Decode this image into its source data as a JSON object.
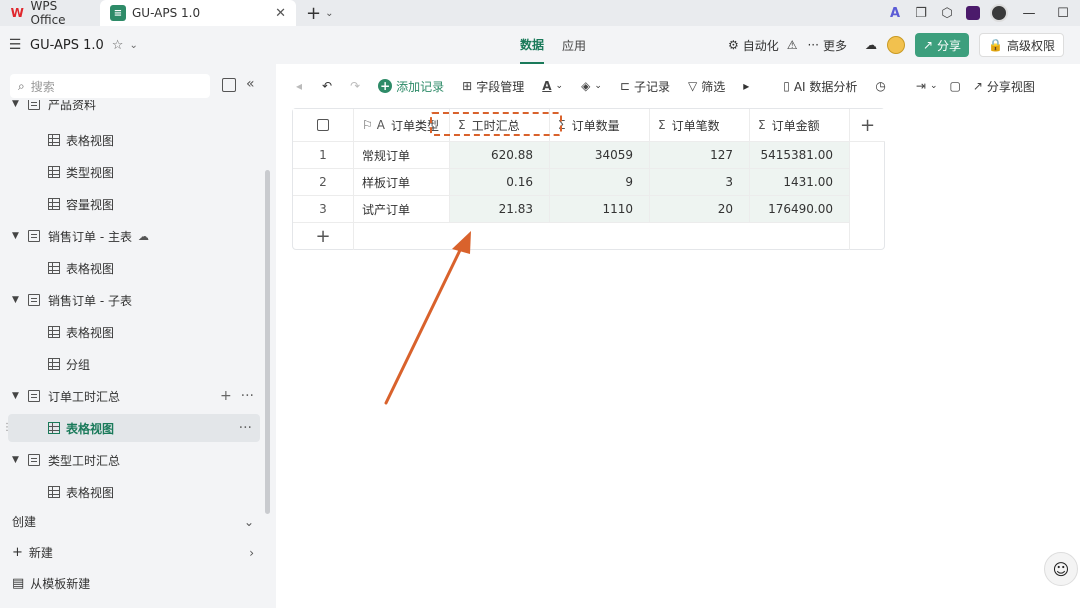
{
  "titlebar": {
    "tabs": [
      {
        "label": "WPS Office",
        "icon": "wps-logo-icon"
      },
      {
        "label": "GU-APS 1.0",
        "icon": "table-app-icon",
        "active": true
      }
    ],
    "close_glyph": "✕",
    "new_tab_glyph": "+",
    "window": {
      "minimize": "—",
      "maximize": "☐"
    }
  },
  "header": {
    "doc_title": "GU-APS 1.0",
    "tabs": [
      "数据",
      "应用"
    ],
    "active_tab": "数据",
    "automation": "自动化",
    "more": "更多",
    "share": "分享",
    "permission": "高级权限"
  },
  "sidebar": {
    "search_placeholder": "搜索",
    "items": [
      {
        "label": "产品资料",
        "type": "table",
        "expanded": true
      },
      {
        "label": "表格视图",
        "type": "view"
      },
      {
        "label": "类型视图",
        "type": "view"
      },
      {
        "label": "容量视图",
        "type": "view"
      },
      {
        "label": "销售订单 - 主表",
        "type": "table",
        "expanded": true
      },
      {
        "label": "表格视图",
        "type": "view"
      },
      {
        "label": "销售订单 - 子表",
        "type": "table",
        "expanded": true
      },
      {
        "label": "表格视图",
        "type": "view"
      },
      {
        "label": "分组",
        "type": "view"
      },
      {
        "label": "订单工时汇总",
        "type": "table",
        "expanded": true
      },
      {
        "label": "表格视图",
        "type": "view",
        "selected": true
      },
      {
        "label": "类型工时汇总",
        "type": "table",
        "expanded": true
      },
      {
        "label": "表格视图",
        "type": "view"
      }
    ],
    "create_section": "创建",
    "new_label": "新建",
    "template_label": "从模板新建"
  },
  "toolbar": {
    "add_record": "添加记录",
    "field_manage": "字段管理",
    "sub_record": "子记录",
    "filter": "筛选",
    "ai_analysis": "AI 数据分析",
    "share_view": "分享视图"
  },
  "table": {
    "columns": [
      {
        "label": "订单类型",
        "icon": "A"
      },
      {
        "label": "工时汇总",
        "icon": "Σ"
      },
      {
        "label": "订单数量",
        "icon": "Σ"
      },
      {
        "label": "订单笔数",
        "icon": "Σ"
      },
      {
        "label": "订单金额",
        "icon": "Σ"
      }
    ],
    "rows": [
      {
        "idx": "1",
        "type": "常规订单",
        "hours": "620.88",
        "qty": "34059",
        "count": "127",
        "amount": "5415381.00"
      },
      {
        "idx": "2",
        "type": "样板订单",
        "hours": "0.16",
        "qty": "9",
        "count": "3",
        "amount": "1431.00"
      },
      {
        "idx": "3",
        "type": "试产订单",
        "hours": "21.83",
        "qty": "1110",
        "count": "20",
        "amount": "176490.00"
      }
    ],
    "add_row": "+",
    "add_col": "+"
  },
  "colors": {
    "accent": "#1a7a5a",
    "share_btn": "#3d9f7d",
    "annotation": "#d9622c",
    "shade": "#eef4f1"
  }
}
